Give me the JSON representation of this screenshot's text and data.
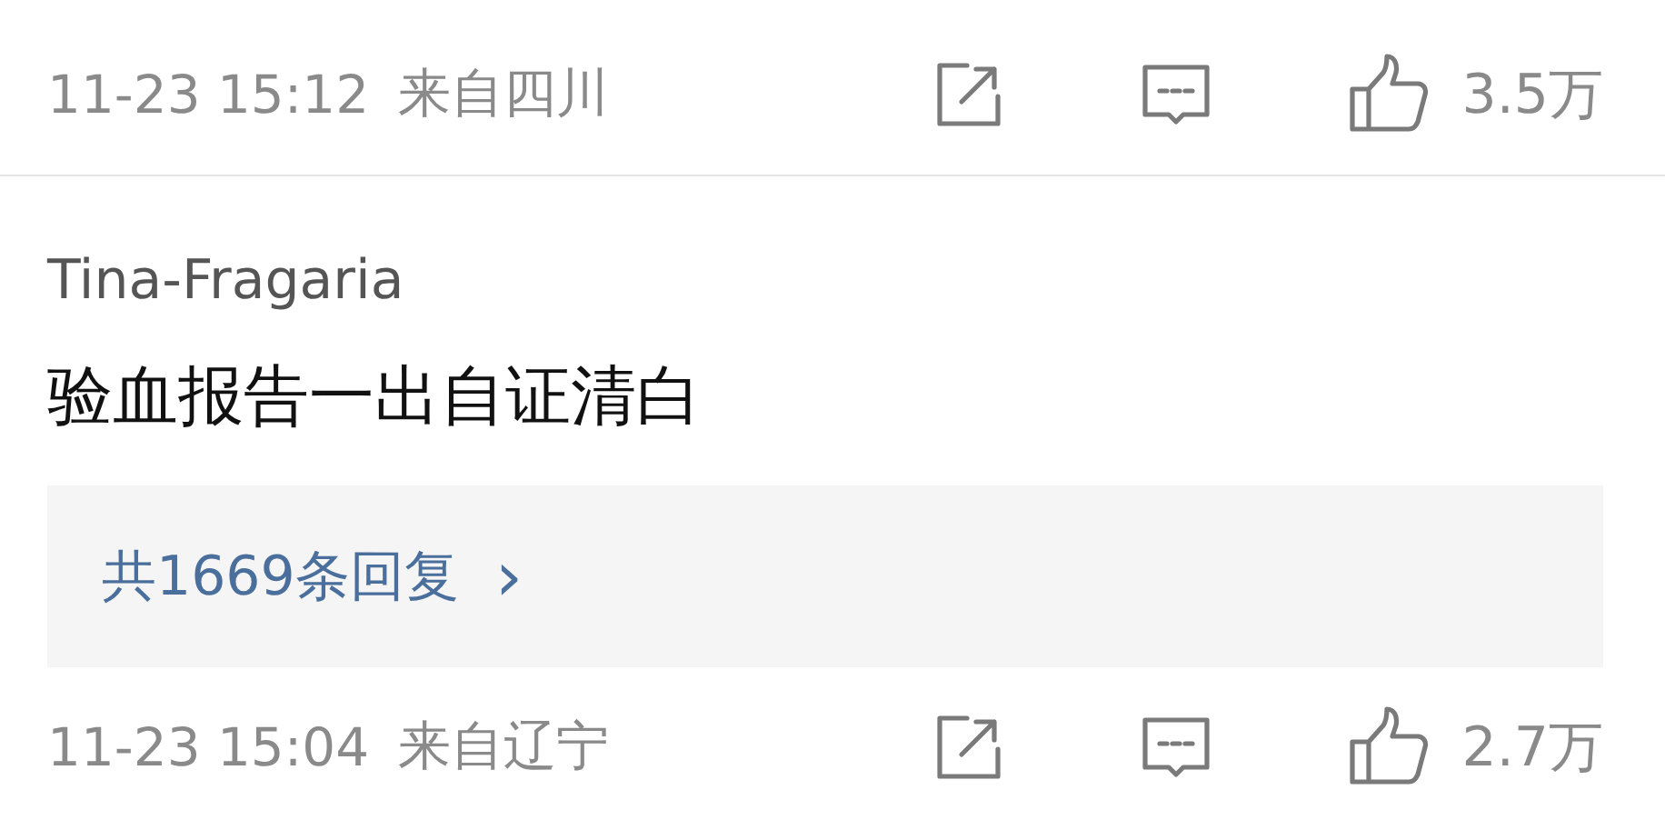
{
  "comments": [
    {
      "meta": {
        "time": "11-23 15:12",
        "location": "来自四川",
        "likes": "3.5万"
      }
    },
    {
      "author": "Tina-Fragaria",
      "text": "验血报告一出自证清白",
      "replies": "共1669条回复",
      "replies_arrow": "›",
      "meta": {
        "time": "11-23 15:04",
        "location": "来自辽宁",
        "likes": "2.7万"
      }
    }
  ]
}
